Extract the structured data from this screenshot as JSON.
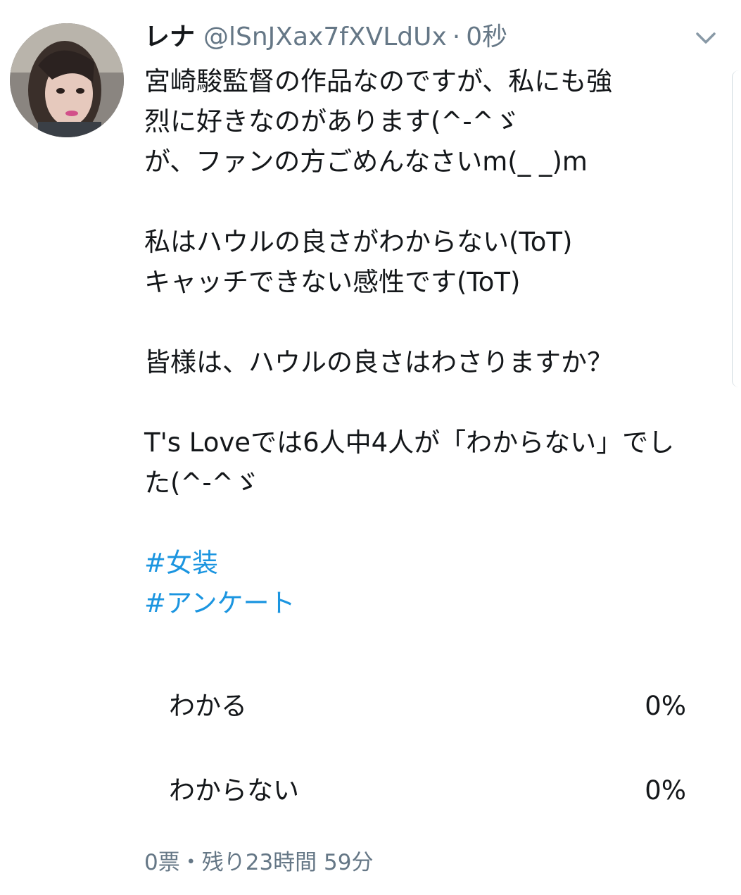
{
  "tweet": {
    "display_name": "レナ",
    "handle": "@lSnJXax7fXVLdUx",
    "separator": "·",
    "timestamp": "0秒",
    "avatar_icon": "user-avatar-photo",
    "menu_icon": "chevron-down-icon",
    "lines": [
      "宮崎駿監督の作品なのですが、私にも強",
      "烈に好きなのがあります(^-^ゞ",
      "が、ファンの方ごめんなさいm(_ _)m",
      "私はハウルの良さがわからない(ToT)",
      "キャッチできない感性です(ToT)",
      "皆様は、ハウルの良さはわさりますか？",
      "T's Loveでは6人中4人が「わからない」でし",
      "た(^-^ゞ"
    ],
    "hashtags": [
      "#女装",
      "#アンケート"
    ]
  },
  "poll": {
    "options": [
      {
        "label": "わかる",
        "percent": "0%",
        "fraction": 0
      },
      {
        "label": "わからない",
        "percent": "0%",
        "fraction": 0
      }
    ],
    "footer": "0票・残り23時間 59分"
  },
  "colors": {
    "text": "#14171a",
    "muted": "#657786",
    "link": "#1b95e0",
    "bar": "#e1e8ed"
  }
}
